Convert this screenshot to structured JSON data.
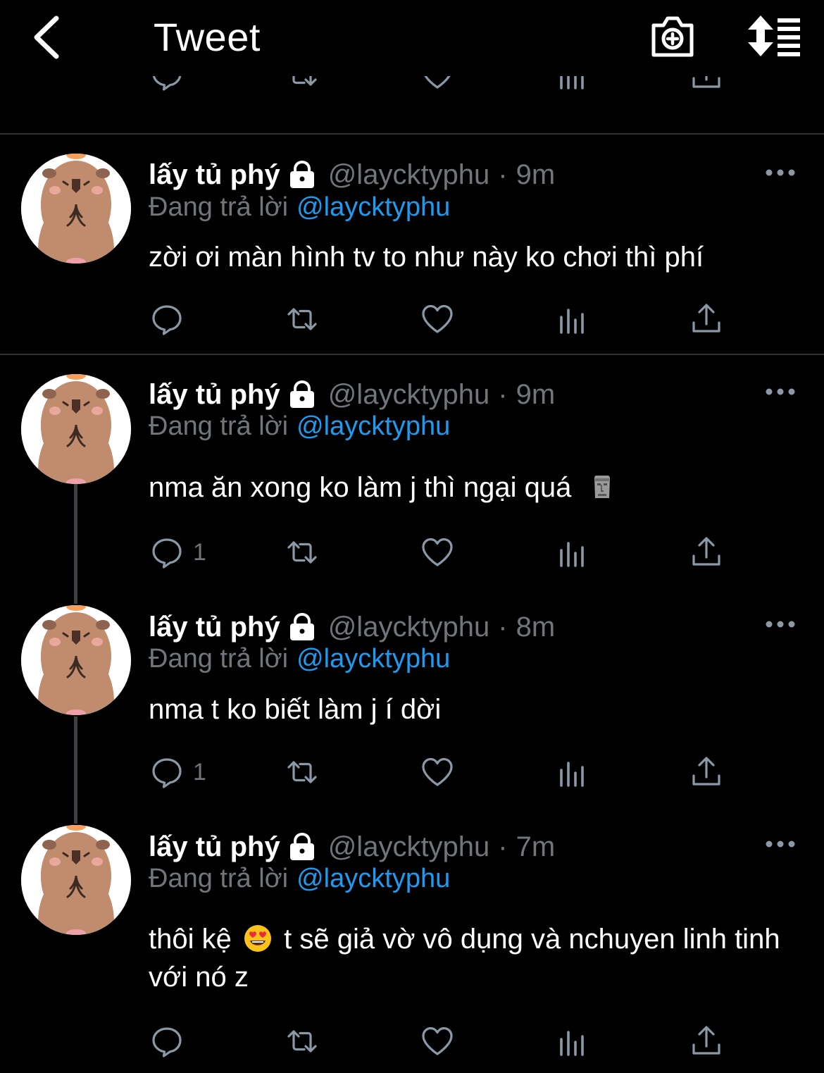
{
  "header": {
    "title": "Tweet"
  },
  "tweets": [
    {
      "name": "lấy tủ phý",
      "handle": "@laycktyphu",
      "dot": "·",
      "time": "9m",
      "reply_prefix": "Đang trả lời",
      "reply_to": "@laycktyphu",
      "text": "zời ơi màn hình tv to như này ko chơi thì phí",
      "reply_count": ""
    },
    {
      "name": "lấy tủ phý",
      "handle": "@laycktyphu",
      "dot": "·",
      "time": "9m",
      "reply_prefix": "Đang trả lời",
      "reply_to": "@laycktyphu",
      "text": "nma ăn xong ko làm j thì ngại quá",
      "emoji": "moai-emoji",
      "reply_count": "1"
    },
    {
      "name": "lấy tủ phý",
      "handle": "@laycktyphu",
      "dot": "·",
      "time": "8m",
      "reply_prefix": "Đang trả lời",
      "reply_to": "@laycktyphu",
      "text": "nma t ko biết làm j í dời",
      "reply_count": "1"
    },
    {
      "name": "lấy tủ phý",
      "handle": "@laycktyphu",
      "dot": "·",
      "time": "7m",
      "reply_prefix": "Đang trả lời",
      "reply_to": "@laycktyphu",
      "text_before": "thôi kệ",
      "emoji": "heart-eyes-emoji",
      "text_after": "t sẽ giả vờ vô dụng và nchuyen linh tinh với nó z",
      "reply_count": ""
    }
  ],
  "colors": {
    "background": "#000000",
    "text": "#ffffff",
    "muted": "#71767b",
    "accent": "#1d9bf0",
    "divider": "#2f3336"
  },
  "icons": [
    "back-arrow-icon",
    "camera-plus-icon",
    "sort-icon",
    "lock-icon",
    "more-icon",
    "reply-icon",
    "retweet-icon",
    "like-icon",
    "views-icon",
    "share-icon"
  ]
}
